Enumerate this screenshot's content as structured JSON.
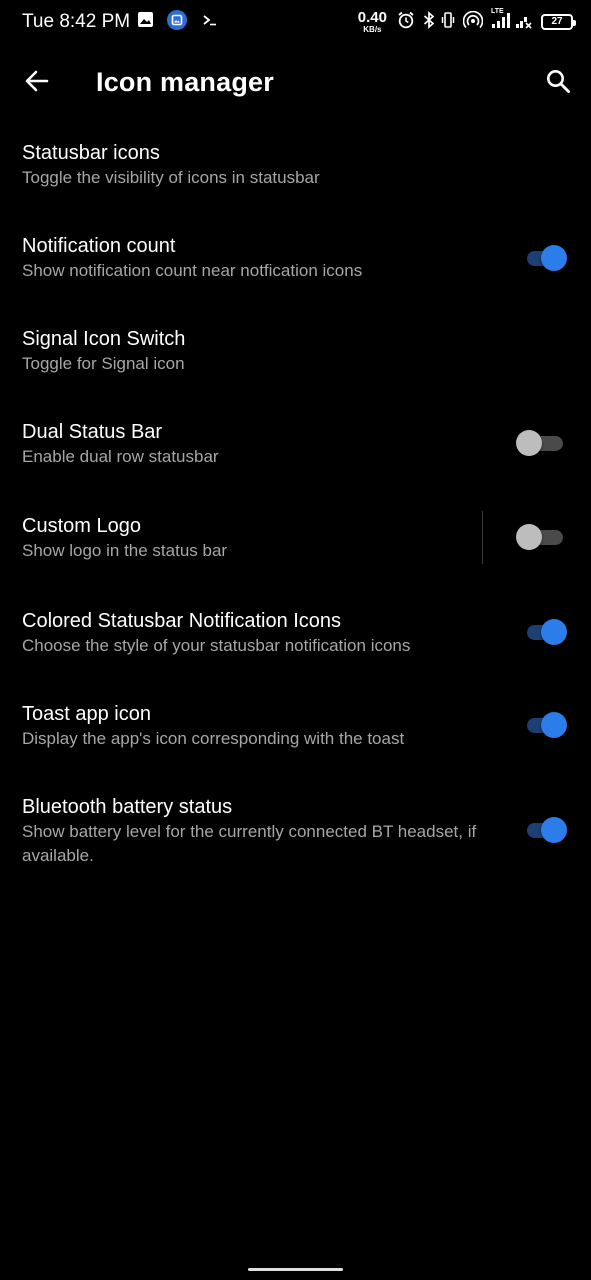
{
  "status_bar": {
    "time": "Tue 8:42 PM",
    "left_icons": [
      "image-icon",
      "gallery-app-icon",
      "terminal-icon"
    ],
    "net_speed_value": "0.40",
    "net_speed_unit": "KB/s",
    "right_icons": [
      "alarm-icon",
      "bluetooth-icon",
      "vibrate-icon",
      "hotspot-icon",
      "lte-signal-icon",
      "signal-icon"
    ],
    "lte_label": "LTE",
    "battery_level": "27"
  },
  "app_bar": {
    "title": "Icon manager",
    "back_icon": "arrow-back-icon",
    "search_icon": "search-icon"
  },
  "settings": [
    {
      "title": "Statusbar icons",
      "summary": "Toggle the visibility of icons in statusbar",
      "has_toggle": false
    },
    {
      "title": "Notification count",
      "summary": "Show notification count near notfication icons",
      "has_toggle": true,
      "on": true
    },
    {
      "title": "Signal Icon Switch",
      "summary": "Toggle for Signal icon",
      "has_toggle": false
    },
    {
      "title": "Dual Status Bar",
      "summary": "Enable dual row statusbar",
      "has_toggle": true,
      "on": false
    },
    {
      "title": "Custom Logo",
      "summary": "Show logo in the status bar",
      "has_toggle": true,
      "on": false
    },
    {
      "title": "Colored Statusbar Notification Icons",
      "summary": "Choose the style of your statusbar notification icons",
      "has_toggle": true,
      "on": true
    },
    {
      "title": "Toast app icon",
      "summary": "Display the app's icon corresponding with the toast",
      "has_toggle": true,
      "on": true
    },
    {
      "title": "Bluetooth battery status",
      "summary": "Show battery level for the currently connected BT headset, if available.",
      "has_toggle": true,
      "on": true
    }
  ],
  "colors": {
    "background": "#000000",
    "accent": "#2b7de9",
    "summary_text": "#a6a6a6"
  }
}
